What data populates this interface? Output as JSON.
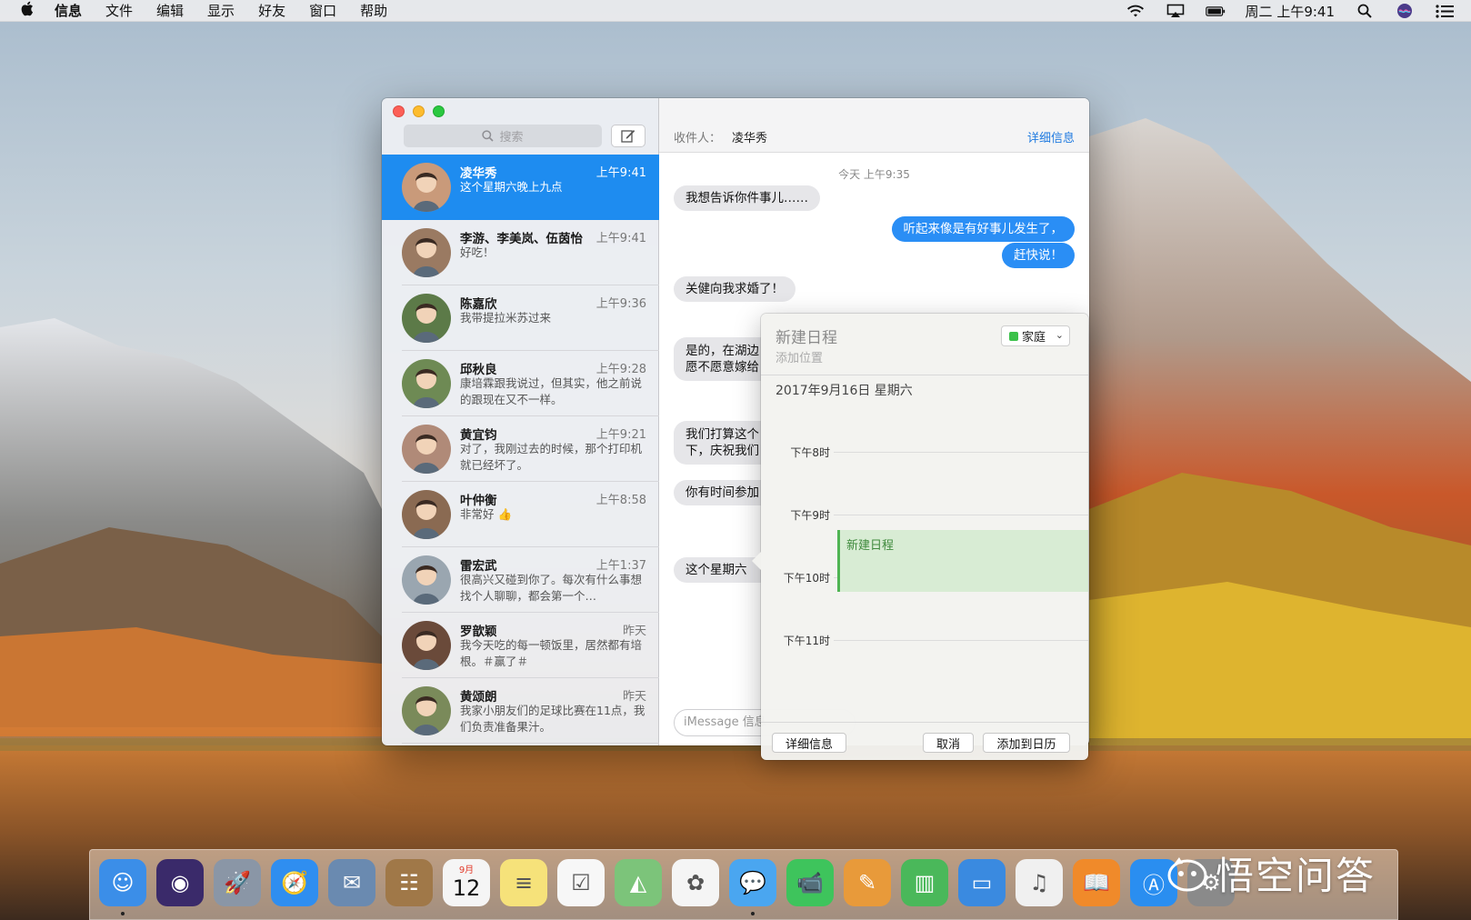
{
  "menubar": {
    "app_name": "信息",
    "menus": [
      "文件",
      "编辑",
      "显示",
      "好友",
      "窗口",
      "帮助"
    ],
    "clock": "周二 上午9:41",
    "tray_icons": [
      "wifi-icon",
      "airplay-icon",
      "battery-icon",
      "spotlight-icon",
      "siri-icon",
      "notification-center-icon"
    ]
  },
  "sidebar": {
    "search_placeholder": "搜索",
    "conversations": [
      {
        "name": "凌华秀",
        "time": "上午9:41",
        "preview": "这个星期六晚上九点",
        "selected": true,
        "avatar_color": "#c99a7a"
      },
      {
        "name": "李游、李美岚、伍茵怡",
        "time": "上午9:41",
        "preview": "好吃！",
        "selected": false,
        "avatar_color": "#9a7a62"
      },
      {
        "name": "陈嘉欣",
        "time": "上午9:36",
        "preview": "我带提拉米苏过来",
        "selected": false,
        "avatar_color": "#5c7a48"
      },
      {
        "name": "邱秋良",
        "time": "上午9:28",
        "preview": "康培霖跟我说过，但其实，他之前说的跟现在又不一样。",
        "selected": false,
        "avatar_color": "#6e8a54"
      },
      {
        "name": "黄宜钧",
        "time": "上午9:21",
        "preview": "对了，我刚过去的时候，那个打印机就已经坏了。",
        "selected": false,
        "avatar_color": "#b08a78"
      },
      {
        "name": "叶仲衡",
        "time": "上午8:58",
        "preview": "非常好 👍",
        "selected": false,
        "avatar_color": "#8a6a52"
      },
      {
        "name": "雷宏武",
        "time": "上午1:37",
        "preview": "很高兴又碰到你了。每次有什么事想找个人聊聊，都会第一个…",
        "selected": false,
        "avatar_color": "#9aa6b0"
      },
      {
        "name": "罗歆颖",
        "time": "昨天",
        "preview": "我今天吃的每一顿饭里，居然都有培根。＃赢了＃",
        "selected": false,
        "avatar_color": "#6a4a3a"
      },
      {
        "name": "黄颂朗",
        "time": "昨天",
        "preview": "我家小朋友们的足球比赛在11点，我们负责准备果汁。",
        "selected": false,
        "avatar_color": "#7a8a5a"
      }
    ]
  },
  "chat": {
    "to_label": "收件人：",
    "to_name": "凌华秀",
    "details_link": "详细信息",
    "timestamp": "今天 上午9:35",
    "messages": [
      {
        "dir": "in",
        "text": "我想告诉你件事儿……"
      },
      {
        "dir": "out",
        "text": "听起来像是有好事儿发生了，"
      },
      {
        "dir": "out",
        "text": "赶快说！"
      },
      {
        "dir": "in",
        "text": "关健向我求婚了！"
      },
      {
        "dir": "in",
        "text": "是的，在湖边"
      },
      {
        "dir": "in",
        "text": "愿不愿意嫁给"
      },
      {
        "dir": "in",
        "text": "我们打算这个"
      },
      {
        "dir": "in",
        "text": "下，庆祝我们"
      },
      {
        "dir": "in",
        "text": "你有时间参加"
      },
      {
        "dir": "in",
        "text": "这个星期六"
      }
    ],
    "input_placeholder": "iMessage 信息"
  },
  "calendar_popover": {
    "title": "新建日程",
    "location_placeholder": "添加位置",
    "calendar_name": "家庭",
    "calendar_color": "#3bc14a",
    "date": "2017年9月16日 星期六",
    "hours": [
      "下午8时",
      "下午9时",
      "下午10时",
      "下午11时"
    ],
    "event_label": "新建日程",
    "buttons": {
      "details": "详细信息",
      "cancel": "取消",
      "add": "添加到日历"
    }
  },
  "dock": {
    "apps": [
      {
        "name": "finder-icon",
        "color": "#3b8ee8",
        "glyph": "☺"
      },
      {
        "name": "siri-icon",
        "color": "#3a2a6a",
        "glyph": "◉"
      },
      {
        "name": "launchpad-icon",
        "color": "#8a96a6",
        "glyph": "🚀"
      },
      {
        "name": "safari-icon",
        "color": "#2f8ef0",
        "glyph": "🧭"
      },
      {
        "name": "mail-icon",
        "color": "#6a8ab0",
        "glyph": "✉"
      },
      {
        "name": "contacts-icon",
        "color": "#a07848",
        "glyph": "☷"
      },
      {
        "name": "calendar-icon",
        "color": "#f5f5f5",
        "glyph": "12"
      },
      {
        "name": "notes-icon",
        "color": "#f6e27a",
        "glyph": "≡"
      },
      {
        "name": "reminders-icon",
        "color": "#f7f7f7",
        "glyph": "☑"
      },
      {
        "name": "maps-icon",
        "color": "#7cc47a",
        "glyph": "◭"
      },
      {
        "name": "photos-icon",
        "color": "#f5f5f5",
        "glyph": "✿"
      },
      {
        "name": "messages-icon",
        "color": "#4aa6f0",
        "glyph": "💬"
      },
      {
        "name": "facetime-icon",
        "color": "#3ec45c",
        "glyph": "📹"
      },
      {
        "name": "pages-icon",
        "color": "#e89a3a",
        "glyph": "✎"
      },
      {
        "name": "numbers-icon",
        "color": "#4ab85a",
        "glyph": "▥"
      },
      {
        "name": "keynote-icon",
        "color": "#3a8ae0",
        "glyph": "▭"
      },
      {
        "name": "itunes-icon",
        "color": "#f0f0f0",
        "glyph": "♫"
      },
      {
        "name": "ibooks-icon",
        "color": "#f08a2a",
        "glyph": "📖"
      },
      {
        "name": "app-store-icon",
        "color": "#2a8ef0",
        "glyph": "Ⓐ"
      },
      {
        "name": "system-preferences-icon",
        "color": "#8a8a8a",
        "glyph": "⚙"
      }
    ],
    "calendar_month": "9月",
    "calendar_day": "12"
  },
  "watermark": {
    "text": "悟空问答"
  }
}
